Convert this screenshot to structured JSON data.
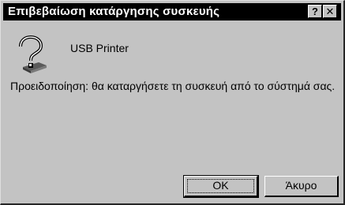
{
  "window": {
    "title": "Επιβεβαίωση κατάργησης συσκευής",
    "help_label": "?",
    "close_label": "✕"
  },
  "device": {
    "name": "USB Printer",
    "icon": "question-printer-icon"
  },
  "message": "Προειδοποίηση: θα καταργήσετε τη συσκευή από το σύστημά σας.",
  "buttons": {
    "ok_label": "OK",
    "cancel_label": "Άκυρο"
  },
  "colors": {
    "titlebar": "#000000",
    "face": "#c3c3c3"
  }
}
